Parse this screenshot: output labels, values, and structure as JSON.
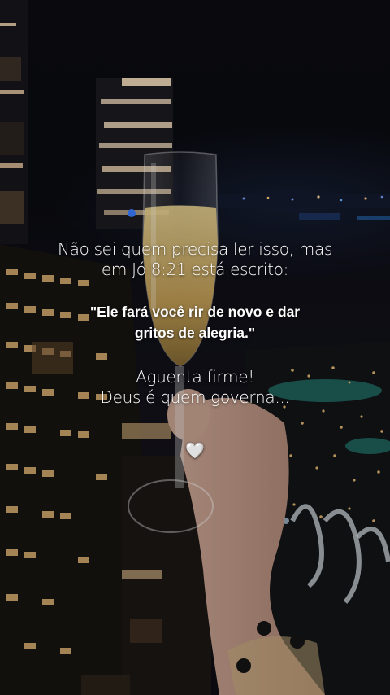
{
  "caption": {
    "intro_line1": "Não sei quem precisa ler isso, mas",
    "intro_line2": "em Jó 8:21 está escrito:",
    "quote_line1": "\"Ele fará você rir de novo e dar",
    "quote_line2": "gritos de alegria.\"",
    "closing_line1": "Aguenta firme!",
    "closing_line2": "Deus é quem governa...",
    "heart": "🤍"
  },
  "colors": {
    "night_sky": "#0a0b10",
    "champagne": "#d9b867",
    "city_lights": "#f2c27a",
    "pool_teal": "#2fb7a8",
    "text": "#ffffff"
  }
}
